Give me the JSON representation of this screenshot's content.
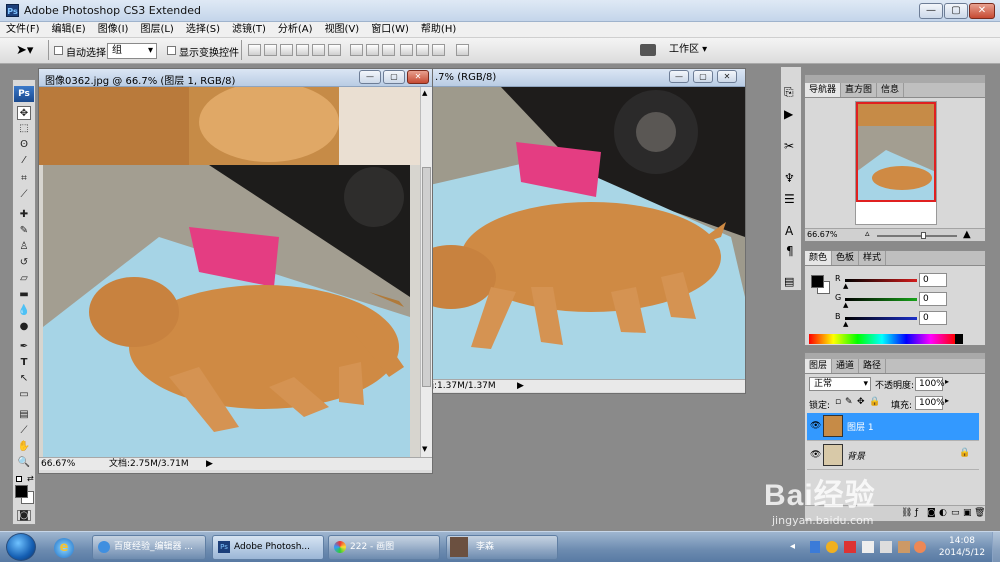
{
  "app": {
    "title": "Adobe Photoshop CS3 Extended",
    "icon": "ps-app-icon"
  },
  "window_controls": {
    "minimize": "—",
    "maximize": "▢",
    "close": "✕"
  },
  "menu": [
    "文件(F)",
    "编辑(E)",
    "图像(I)",
    "图层(L)",
    "选择(S)",
    "滤镜(T)",
    "分析(A)",
    "视图(V)",
    "窗口(W)",
    "帮助(H)"
  ],
  "options": {
    "auto_select_label": "自动选择:",
    "auto_select_value": "组",
    "show_transform_label": "显示变换控件",
    "workspace_label": "工作区 ▾"
  },
  "toolbox": {
    "logo": "Ps"
  },
  "doc_front": {
    "title": "图像0362.jpg @ 66.7% (图层 1, RGB/8)",
    "zoom": "66.67%",
    "doc_size": "文档:2.75M/3.71M"
  },
  "doc_back": {
    "title_visible": ".7% (RGB/8)",
    "doc_size": "档:1.37M/1.37M"
  },
  "navigator_panel": {
    "tabs": [
      "导航器",
      "直方图",
      "信息"
    ],
    "zoom": "66.67%"
  },
  "color_panel": {
    "tabs": [
      "颜色",
      "色板",
      "样式"
    ],
    "channels": [
      {
        "label": "R",
        "value": "0"
      },
      {
        "label": "G",
        "value": "0"
      },
      {
        "label": "B",
        "value": "0"
      }
    ],
    "colors": {
      "r_track": "#d21d1d",
      "g_track": "#18a31a",
      "b_track": "#1c2fc9"
    }
  },
  "layers_panel": {
    "tabs": [
      "图层",
      "通道",
      "路径"
    ],
    "blend_mode": "正常",
    "opacity_label": "不透明度:",
    "opacity_value": "100%",
    "lock_label": "锁定:",
    "fill_label": "填充:",
    "fill_value": "100%",
    "layers": [
      {
        "name": "图层 1",
        "selected": true
      },
      {
        "name": "背景",
        "selected": false,
        "locked": true
      }
    ],
    "selection_color": "#3399ff"
  },
  "taskbar": {
    "buttons": [
      {
        "label": "百度经验_编辑器 ..."
      },
      {
        "label": "Adobe Photosh..."
      },
      {
        "label": "222 - 画图"
      },
      {
        "label": "李森"
      }
    ],
    "clock_time": "14:08",
    "clock_date": "2014/5/12"
  },
  "watermark": {
    "line1": "Bai经验",
    "line2": "jingyan.baidu.com"
  }
}
